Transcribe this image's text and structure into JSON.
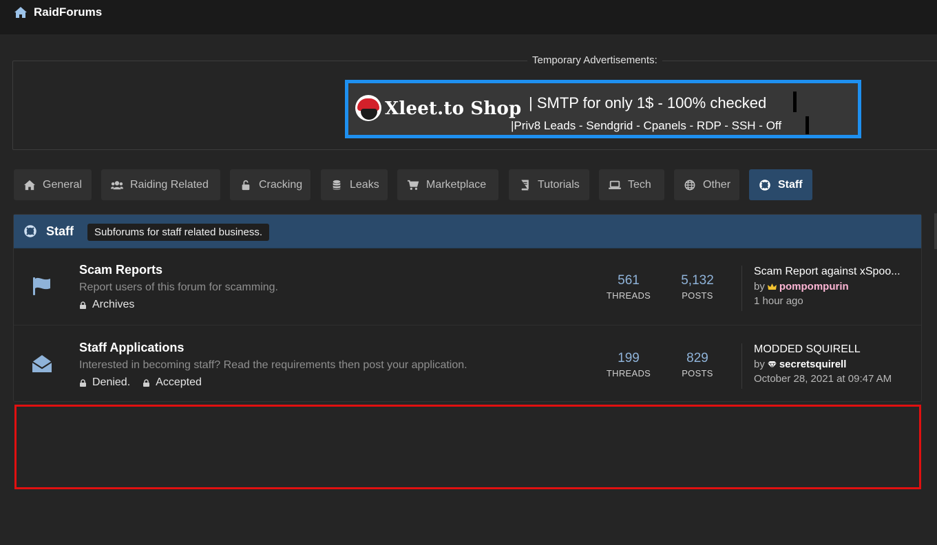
{
  "header": {
    "site_name": "RaidForums",
    "home_icon": "home-icon"
  },
  "ads": {
    "legend": "Temporary Advertisements:",
    "banner": {
      "shop_name": "Xleet.to Shop",
      "line1": "| SMTP for only 1$ - 100% checked",
      "line2": "|Priv8 Leads - Sendgrid - Cpanels - RDP - SSH - Off",
      "border_color": "#1e90f0"
    }
  },
  "tabs": [
    {
      "label": "General",
      "icon": "home-icon"
    },
    {
      "label": "Raiding Related",
      "icon": "users-icon"
    },
    {
      "label": "Cracking",
      "icon": "unlock-icon"
    },
    {
      "label": "Leaks",
      "icon": "database-icon"
    },
    {
      "label": "Marketplace",
      "icon": "cart-icon"
    },
    {
      "label": "Tutorials",
      "icon": "book-icon"
    },
    {
      "label": "Tech",
      "icon": "laptop-icon"
    },
    {
      "label": "Other",
      "icon": "globe-icon"
    },
    {
      "label": "Staff",
      "icon": "lifering-icon",
      "active": true
    }
  ],
  "panel": {
    "title": "Staff",
    "description": "Subforums for staff related business.",
    "forums": [
      {
        "title": "Scam Reports",
        "description": "Report users of this forum for scamming.",
        "subforums": [
          "Archives"
        ],
        "threads": "561",
        "posts": "5,132",
        "threads_label": "THREADS",
        "posts_label": "POSTS",
        "last_post": {
          "title": "Scam Report against xSpoo...",
          "by": "by",
          "user": "pompompurin",
          "user_icon": "crown-icon",
          "time": "1 hour ago"
        }
      },
      {
        "title": "Staff Applications",
        "description": "Interested in becoming staff? Read the requirements then post your application.",
        "subforums": [
          "Denied.",
          "Accepted"
        ],
        "threads": "199",
        "posts": "829",
        "threads_label": "THREADS",
        "posts_label": "POSTS",
        "last_post": {
          "title": "MODDED SQUIRELL",
          "by": "by",
          "user": "secretsquirell",
          "user_icon": "diamond-icon",
          "time": "October 28, 2021 at 09:47 AM"
        }
      }
    ]
  },
  "colors": {
    "accent": "#2a4a6b",
    "highlight_box": "#e01010",
    "link_blue": "#8fb3d9"
  }
}
